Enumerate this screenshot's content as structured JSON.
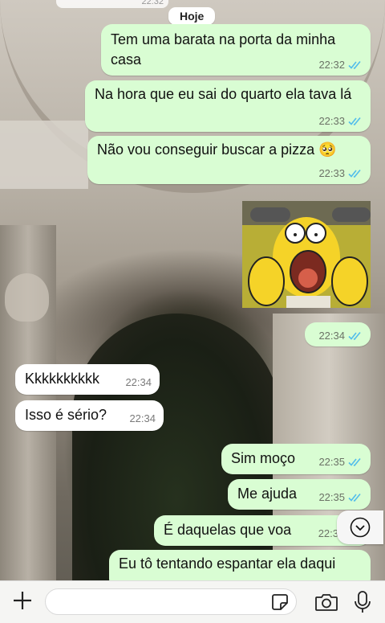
{
  "chat": {
    "top_peek_time": "22:32",
    "day_label": "Hoje",
    "messages": [
      {
        "direction": "out",
        "text": "Tem uma barata na porta da minha casa",
        "time": "22:32"
      },
      {
        "direction": "out",
        "text": "Na hora que eu sai do quarto ela tava lá",
        "time": "22:33"
      },
      {
        "direction": "out",
        "text": "Não vou conseguir buscar a pizza 🥺",
        "time": "22:33"
      },
      {
        "direction": "out",
        "type": "sticker",
        "sticker": "homer-simpson-screaming",
        "time": "22:34"
      },
      {
        "direction": "in",
        "text": "Kkkkkkkkkk",
        "time": "22:34"
      },
      {
        "direction": "in",
        "text": "Isso é sério?",
        "time": "22:34"
      },
      {
        "direction": "out",
        "text": "Sim moço",
        "time": "22:35"
      },
      {
        "direction": "out",
        "text": "Me ajuda",
        "time": "22:35"
      },
      {
        "direction": "out",
        "text": "É daquelas que voa",
        "time": "22:3"
      },
      {
        "direction": "out",
        "text": "Eu tô tentando espantar ela daqui",
        "time": ""
      }
    ],
    "read_status": "read",
    "colors": {
      "outgoing_bubble": "#d9fdd3",
      "incoming_bubble": "#ffffff",
      "read_ticks": "#53bdeb"
    }
  },
  "composer": {
    "plus_icon": "plus-icon",
    "input_value": "",
    "sticker_icon": "sticker-icon",
    "camera_icon": "camera-icon",
    "mic_icon": "microphone-icon"
  },
  "scroll_down_icon": "chevron-down-icon"
}
